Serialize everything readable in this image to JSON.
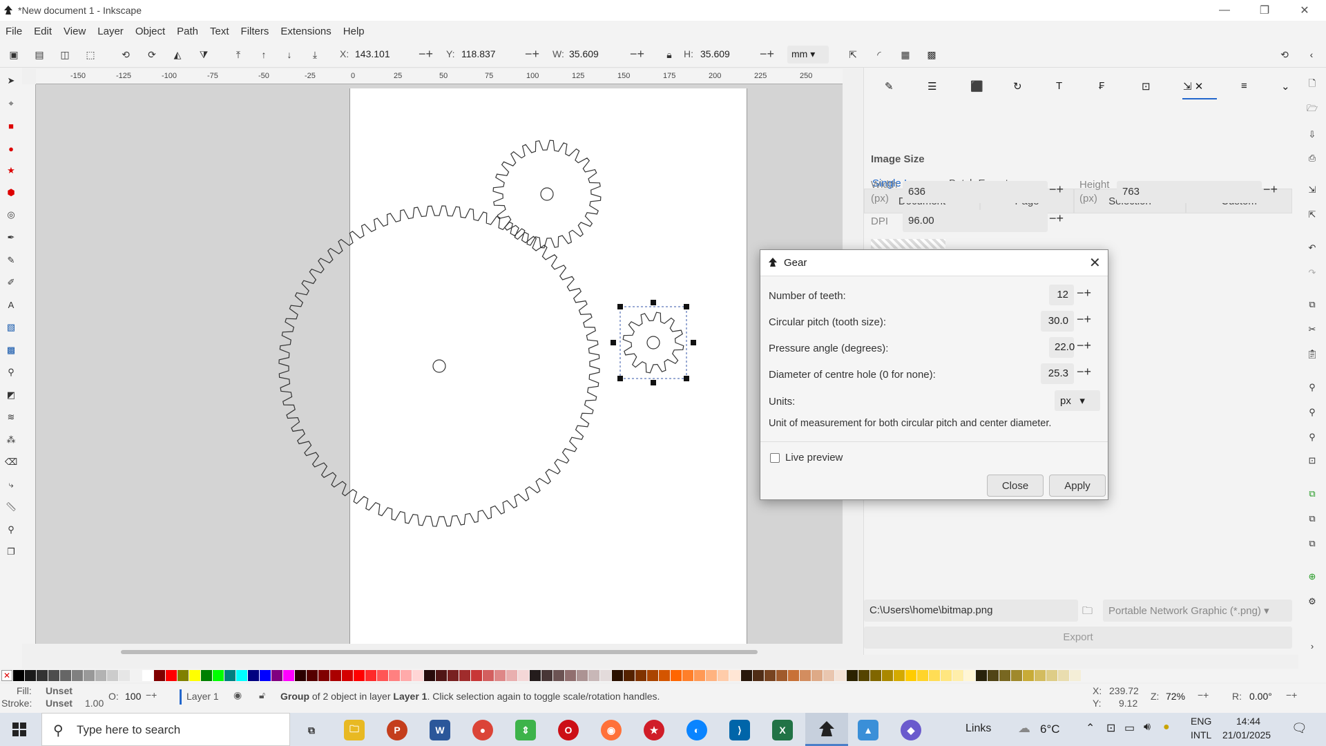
{
  "window": {
    "title": "*New document 1 - Inkscape",
    "minimize": "—",
    "restore": "❐",
    "close": "✕"
  },
  "menu": [
    "File",
    "Edit",
    "View",
    "Layer",
    "Object",
    "Path",
    "Text",
    "Filters",
    "Extensions",
    "Help"
  ],
  "toolbar": {
    "x_label": "X:",
    "x_value": "143.101",
    "y_label": "Y:",
    "y_value": "118.837",
    "w_label": "W:",
    "w_value": "35.609",
    "h_label": "H:",
    "h_value": "35.609",
    "unit": "mm"
  },
  "ruler": {
    "ticks": [
      "-150",
      "-125",
      "-100",
      "-75",
      "-50",
      "-25",
      "0",
      "25",
      "50",
      "75",
      "100",
      "125",
      "150",
      "175",
      "200",
      "225",
      "250"
    ]
  },
  "export_dock": {
    "tabs": [
      "Single Image",
      "Batch Export"
    ],
    "areas": [
      "Document",
      "Page",
      "Selection",
      "Custom"
    ],
    "image_size_title": "Image Size",
    "width_label": "Width",
    "width_unit": "(px)",
    "width_value": "636",
    "height_label": "Height",
    "height_unit": "(px)",
    "height_value": "763",
    "dpi_label": "DPI",
    "dpi_value": "96.00",
    "filename": "C:\\Users\\home\\bitmap.png",
    "format": "Portable Network Graphic (*.png)",
    "export_button": "Export"
  },
  "gear_dialog": {
    "title": "Gear",
    "teeth_label": "Number of teeth:",
    "teeth_value": "12",
    "pitch_label": "Circular pitch (tooth size):",
    "pitch_value": "30.0",
    "pressure_label": "Pressure angle (degrees):",
    "pressure_value": "22.0",
    "hole_label": "Diameter of centre hole (0 for none):",
    "hole_value": "25.3",
    "units_label": "Units:",
    "units_value": "px",
    "units_help": "Unit of measurement for both circular pitch and center diameter.",
    "live_preview_label": "Live preview",
    "close_button": "Close",
    "apply_button": "Apply"
  },
  "status": {
    "fill_label": "Fill:",
    "fill_value": "Unset",
    "stroke_label": "Stroke:",
    "stroke_value": "Unset",
    "stroke_width": "1.00",
    "opacity_label": "O:",
    "opacity_value": "100",
    "layer": "Layer 1",
    "message_bold": "Group",
    "message": " of 2 object in layer ",
    "message_layer": "Layer 1",
    "message_tail": ". Click selection again to toggle scale/rotation handles.",
    "cursor_x_label": "X:",
    "cursor_x": "239.72",
    "cursor_y_label": "Y:",
    "cursor_y": "9.12",
    "zoom_label": "Z:",
    "zoom_value": "72%",
    "rotate_label": "R:",
    "rotate_value": "0.00°"
  },
  "taskbar": {
    "search_placeholder": "Type here to search",
    "links": "Links",
    "weather": "6°C",
    "lang_1": "ENG",
    "lang_2": "INTL",
    "time": "14:44",
    "date": "21/01/2025"
  },
  "palette_colors": [
    "#000000",
    "#1a1a1a",
    "#333333",
    "#4d4d4d",
    "#666666",
    "#808080",
    "#999999",
    "#b3b3b3",
    "#cccccc",
    "#e6e6e6",
    "#f2f2f2",
    "#ffffff",
    "#800000",
    "#ff0000",
    "#808000",
    "#ffff00",
    "#008000",
    "#00ff00",
    "#008080",
    "#00ffff",
    "#000080",
    "#0000ff",
    "#800080",
    "#ff00ff",
    "#2b0000",
    "#550000",
    "#800000",
    "#aa0000",
    "#d40000",
    "#ff0000",
    "#ff2a2a",
    "#ff5555",
    "#ff8080",
    "#ffaaaa",
    "#ffd5d5",
    "#280b0b",
    "#501616",
    "#782121",
    "#a02c2c",
    "#c83737",
    "#d35f5f",
    "#de8787",
    "#e9afaf",
    "#f4d7d7",
    "#241c1c",
    "#483737",
    "#6c5353",
    "#916f6f",
    "#ac9393",
    "#c8b7b7",
    "#e3dbdb",
    "#2b1100",
    "#552200",
    "#803300",
    "#aa4400",
    "#d45500",
    "#ff6600",
    "#ff7f2a",
    "#ff9955",
    "#ffb380",
    "#ffccaa",
    "#ffe6d5",
    "#28170b",
    "#502d16",
    "#784421",
    "#a05a2c",
    "#c87137",
    "#d38d5f",
    "#deaa87",
    "#e9c6af",
    "#f4e3d7",
    "#2b2200",
    "#554400",
    "#806600",
    "#aa8800",
    "#d4aa00",
    "#ffcc00",
    "#ffd42a",
    "#ffdd55",
    "#ffe680",
    "#ffeeaa",
    "#fff6d5",
    "#28220b",
    "#504416",
    "#786721",
    "#a0892c",
    "#c8ab37",
    "#d3bc5f",
    "#decd87",
    "#e9ddaf",
    "#f4eed7"
  ]
}
